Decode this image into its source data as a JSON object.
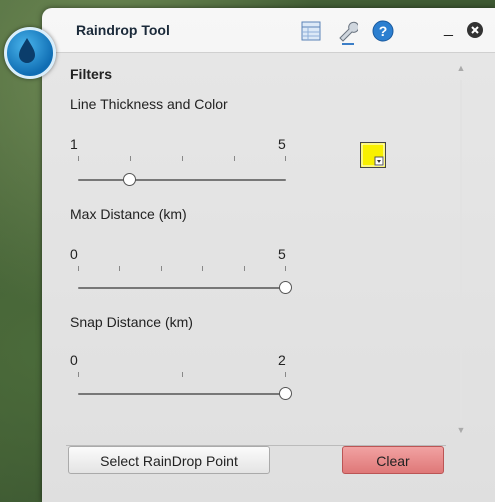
{
  "window": {
    "title": "Raindrop Tool",
    "minimize": "_"
  },
  "filters": {
    "heading": "Filters",
    "line": {
      "label": "Line Thickness and Color",
      "min": "1",
      "max": "5",
      "value": 2,
      "color": "#f8f000"
    },
    "max_distance": {
      "label": "Max Distance (km)",
      "min": "0",
      "max": "5",
      "value": 5
    },
    "snap_distance": {
      "label": "Snap Distance (km)",
      "min": "0",
      "max": "2",
      "value": 2
    }
  },
  "buttons": {
    "select": "Select RainDrop Point",
    "clear": "Clear"
  },
  "colors": {
    "accent_blue": "#0f6db3",
    "clear_button": "#e88b8b"
  }
}
